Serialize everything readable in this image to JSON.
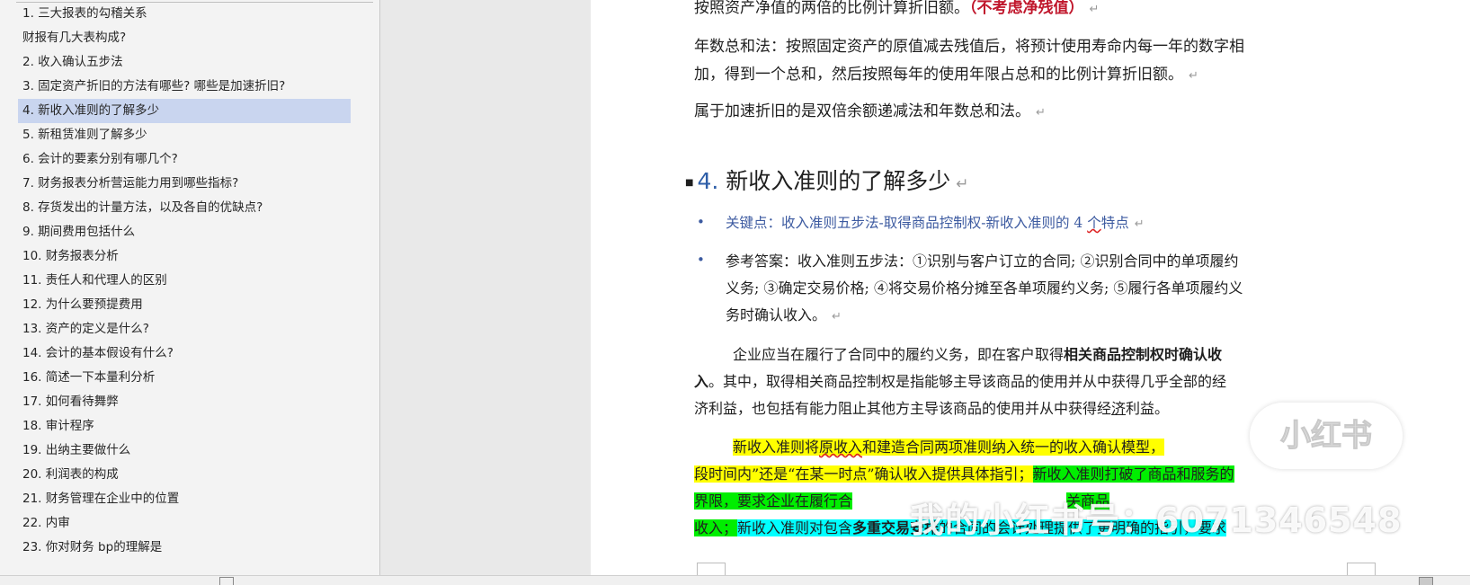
{
  "nav": {
    "items": [
      "1. 三大报表的勾稽关系",
      "财报有几大表构成?",
      "2. 收入确认五步法",
      "3. 固定资产折旧的方法有哪些? 哪些是加速折旧?",
      "4. 新收入准则的了解多少",
      "5. 新租赁准则了解多少",
      "6. 会计的要素分别有哪几个?",
      "7. 财务报表分析营运能力用到哪些指标?",
      "8. 存货发出的计量方法，以及各自的优缺点?",
      "9. 期间费用包括什么",
      "10. 财务报表分析",
      "11. 责任人和代理人的区别",
      "12. 为什么要预提费用",
      "13. 资产的定义是什么?",
      "14. 会计的基本假设有什么?",
      "16. 简述一下本量利分析",
      "17. 如何看待舞弊",
      "18. 审计程序",
      "19. 出纳主要做什么",
      "20. 利润表的构成",
      "21. 财务管理在企业中的位置",
      "22. 内审",
      "23. 你对财务 bp的理解是"
    ],
    "selected_index": 4
  },
  "doc": {
    "p1": {
      "text": "按照资产净值的两倍的比例计算折旧额。",
      "red": "（不考虑净残值）"
    },
    "p2": {
      "line1": "年数总和法：按照固定资产的原值减去残值后，将预计使用寿命内每一年的数字相",
      "line2": "加，得到一个总和，然后按照每年的使用年限占总和的比例计算折旧额。"
    },
    "p3": "属于加速折旧的是双倍余额递减法和年数总和法。",
    "heading": {
      "number": "4.",
      "title": "新收入准则的了解多少"
    },
    "bullet1": {
      "a": "关键点：收入准则五步法-取得商品控制权-新收入准则的 4 ",
      "b": "个",
      "c": "特点"
    },
    "bullet2": {
      "line1": "参考答案：收入准则五步法：①识别与客户订立的合同; ②识别合同中的单项履约",
      "line2": "义务; ③确定交易价格; ④将交易价格分摊至各单项履约义务; ⑤履行各单项履约义",
      "line3": "务时确认收入。"
    },
    "p4": {
      "line1a": "企业应当在履行了合同中的履约义务，即在客户取得",
      "line1b": "相关商品控制权时确认收",
      "line2a": "入",
      "line2b": "。其中，取得相关商品控制权是指能够主导该商品的使用并从中获得几乎全部的经",
      "line3a": "济利益，也包括有能力阻止其他方主导该商品的使用并从中获得经",
      "line3b": "济",
      "line3c": "利益。"
    },
    "p5": {
      "line1a": "新收入准则将",
      "line1b": "原收入",
      "line1c": "和建造合同两项准则纳入统一的收入确认模型，",
      "line2a": "段时间内”还是“在某一时点”确认收入提供具体指引；",
      "line2b": "新收入准则打破了商品和服务的",
      "line3a": "界限，要求企业在履行合",
      "line3b": "关商品",
      "line4a": "收入；",
      "line4b": "新收入准则对包含",
      "line4c": "多重交易安排",
      "line4d": "的合同的会计处理提供了更明确的指引，要求"
    },
    "paragraph_mark": "↵"
  },
  "watermark": {
    "logo": "小红书",
    "text": "我的小红书号：6071346548"
  },
  "colors": {
    "selected_bg": "#c9d5ef",
    "heading_number": "#2e5ea8",
    "keypoint": "#3c5aa0",
    "red_note": "#c0162b",
    "highlight_yellow": "#ffff00",
    "highlight_green": "#00ee00",
    "highlight_cyan": "#00ffff"
  }
}
